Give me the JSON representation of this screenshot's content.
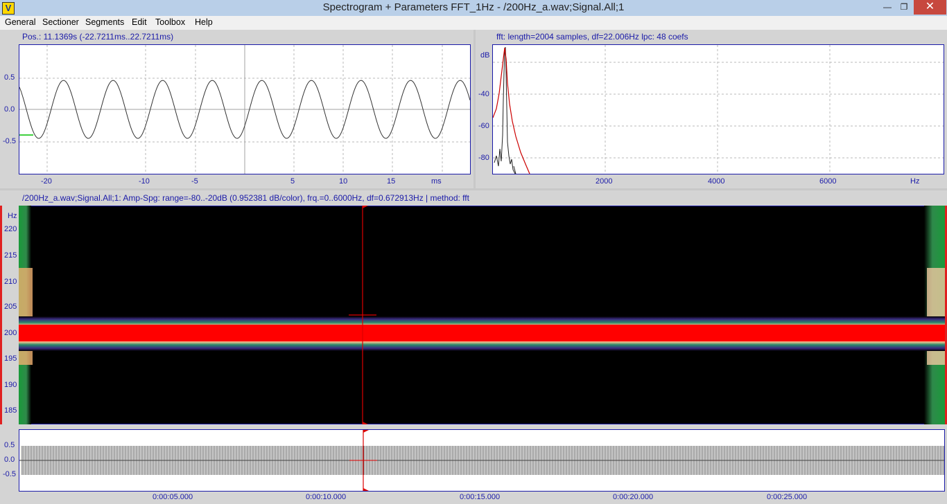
{
  "window": {
    "app_icon_letter": "V",
    "title": "Spectrogram + Parameters FFT_1Hz - /200Hz_a.wav;Signal.All;1",
    "minimize_glyph": "—",
    "restore_glyph": "❐",
    "close_glyph": "✕"
  },
  "menu": {
    "items": [
      "General",
      "Sectioner",
      "Segments",
      "Edit",
      "Toolbox",
      "Help"
    ]
  },
  "oscillogram": {
    "caption": "Pos.: 11.1369s (-22.7211ms..22.7211ms)",
    "y_ticks": [
      "0.5",
      "0.0",
      "-0.5"
    ],
    "x_ticks": [
      "-20",
      "-10",
      "-5",
      "5",
      "10",
      "15",
      "ms"
    ],
    "chart_data": {
      "type": "line",
      "signal": "sine",
      "frequency_hz": 200,
      "amplitude": 0.45,
      "xlim_ms": [
        -22.7211,
        22.7211
      ],
      "ylim": [
        -1,
        1
      ],
      "x_unit": "ms",
      "marker_color": "#00c000"
    }
  },
  "spectrum": {
    "caption": "fft: length=2004 samples, df=22.006Hz lpc: 48 coefs",
    "y_unit": "dB",
    "y_ticks": [
      "-40",
      "-60",
      "-80"
    ],
    "x_ticks": [
      "2000",
      "4000",
      "6000",
      "Hz"
    ],
    "chart_data": {
      "type": "line",
      "x_unit": "Hz",
      "y_unit": "dB",
      "xlim": [
        0,
        8000
      ],
      "ylim": [
        -90,
        -20
      ],
      "peak_hz": 200,
      "series": [
        {
          "name": "fft",
          "color": "#000000"
        },
        {
          "name": "lpc",
          "color": "#cc0000"
        }
      ]
    }
  },
  "spectrogram": {
    "caption": "/200Hz_a.wav;Signal.All;1: Amp-Spg: range=-80..-20dB (0.952381 dB/color), frq.=0..6000Hz, df=0.672913Hz | method: fft",
    "y_unit": "Hz",
    "y_ticks": [
      "220",
      "215",
      "210",
      "205",
      "200",
      "195",
      "190",
      "185"
    ],
    "chart_data": {
      "type": "heatmap",
      "y_unit": "Hz",
      "ylim": [
        182,
        223
      ],
      "band_center_hz": 200,
      "range_db": [
        -80,
        -20
      ],
      "cursor_color": "#dd0000",
      "band_color": "#ff0000"
    }
  },
  "overview": {
    "y_ticks": [
      "0.5",
      "0.0",
      "-0.5"
    ],
    "x_ticks": [
      "0:00:05.000",
      "0:00:10.000",
      "0:00:15.000",
      "0:00:20.000",
      "0:00:25.000"
    ],
    "chart_data": {
      "type": "line",
      "x_unit": "s",
      "xlim": [
        0,
        29.6
      ],
      "cursor_s": 11.1369,
      "amplitude": 0.45
    }
  }
}
